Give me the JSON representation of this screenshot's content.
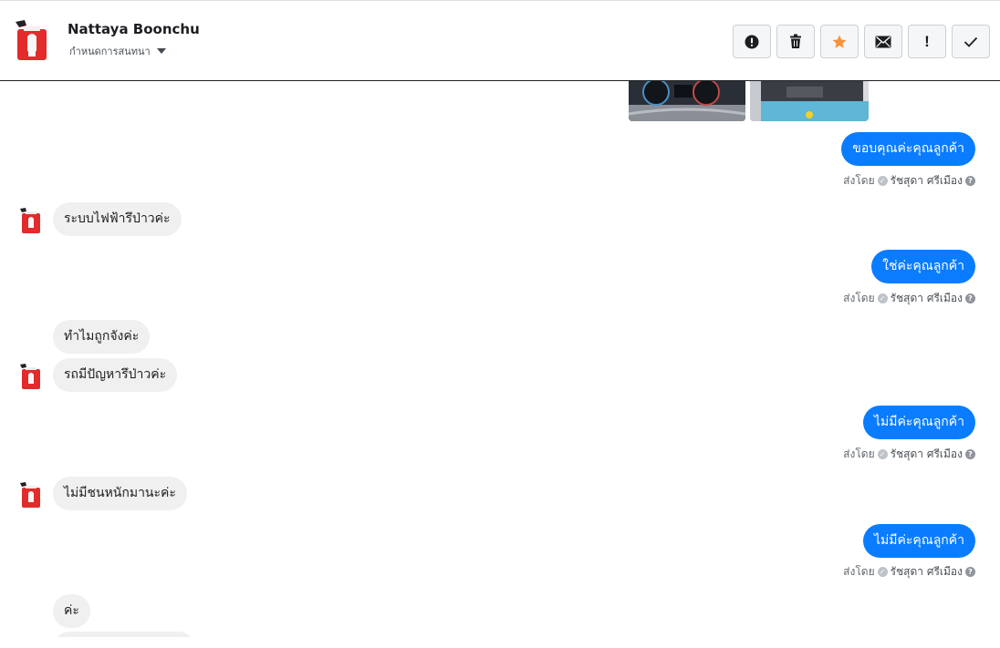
{
  "header": {
    "contact_name": "Nattaya Boonchu",
    "assign_label": "กำหนดการสนทนา",
    "toolbar": [
      {
        "name": "spam-button",
        "icon": "exclamation-circle-icon"
      },
      {
        "name": "delete-button",
        "icon": "trash-icon"
      },
      {
        "name": "star-button",
        "icon": "star-icon",
        "color": "#f7923b"
      },
      {
        "name": "mark-unread-button",
        "icon": "envelope-icon"
      },
      {
        "name": "follow-up-button",
        "icon": "exclamation-icon",
        "label": "!"
      },
      {
        "name": "mark-done-button",
        "icon": "checkmark-icon"
      }
    ]
  },
  "colors": {
    "outgoing_bubble": "#0a7cff",
    "incoming_bubble": "#f0f0f0",
    "star": "#f7923b"
  },
  "sent_by_label": "ส่งโดย",
  "agent_name": "รัชสุดา ศรีเมือง",
  "messages": [
    {
      "dir": "out",
      "text": "ขอบคุณค่ะคุณลูกค้า"
    },
    {
      "dir": "in",
      "text": "ระบบไฟฟ้ารึป่าวค่ะ"
    },
    {
      "dir": "out",
      "text": "ใช่ค่ะคุณลูกค้า"
    },
    {
      "dir": "in",
      "text": "ทำไมถูกจังค่ะ"
    },
    {
      "dir": "in",
      "text": "รถมีปัญหารึป่าวค่ะ"
    },
    {
      "dir": "out",
      "text": "ไม่มีค่ะคุณลูกค้า"
    },
    {
      "dir": "in",
      "text": "ไม่มีชนหนักมานะค่ะ"
    },
    {
      "dir": "out",
      "text": "ไม่มีค่ะคุณลูกค้า"
    },
    {
      "dir": "in",
      "text": "ค่ะ"
    }
  ]
}
